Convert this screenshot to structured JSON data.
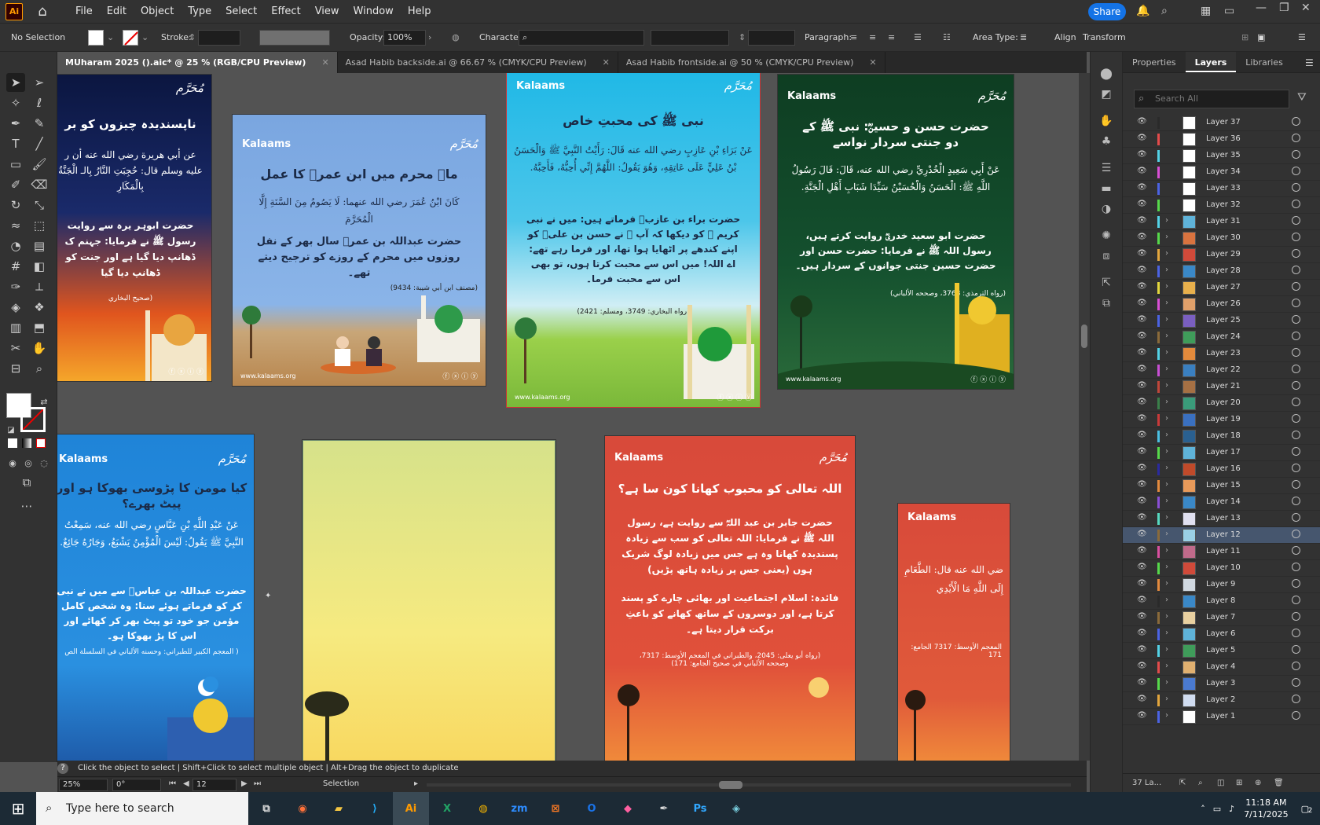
{
  "menubar": {
    "logo": "Ai",
    "items": [
      "File",
      "Edit",
      "Object",
      "Type",
      "Select",
      "Effect",
      "View",
      "Window",
      "Help"
    ],
    "share": "Share"
  },
  "control": {
    "selection": "No Selection",
    "stroke_label": "Stroke:",
    "opacity_label": "Opacity:",
    "opacity_value": "100%",
    "character_label": "Character:",
    "paragraph_label": "Paragraph:",
    "area_type_label": "Area Type:",
    "align": "Align",
    "transform": "Transform"
  },
  "tabs": [
    {
      "label": "MUharam 2025 ().aic* @ 25 % (RGB/CPU Preview)"
    },
    {
      "label": "Asad Habib backside.ai @ 66.67 % (CMYK/CPU Preview)"
    },
    {
      "label": "Asad Habib frontside.ai @ 50 % (CMYK/CPU Preview)"
    }
  ],
  "artboards": {
    "brand": "Kalaams",
    "muharram": "مُحَرَّم",
    "website": "www.kalaams.org",
    "social": "ⓕ ⓧ ⓘ ⓨ",
    "a1": {
      "title": "ناپسندیدہ چیزوں کو بر",
      "arabic": "عن أبي هريرة رضي الله عنه أن ر عليه وسلم قال: حُجِبَتِ النَّارُ بِالـ الْجَنَّةُ بِالْمَكَارِ",
      "urdu": "حضرت ابوہر یرہ سے روایت رسول ﷺ نے فرمایا: جہنم ک ڈھانپ دیا گیا ہے اور جنت کو ڈھانپ دیا گیا",
      "ref": "(صحيح البخاري"
    },
    "a2": {
      "title": "ماہ محرم میں ابن عمرؓ کا عمل",
      "arabic": "كَانَ ابْنُ عُمَرَ رضي الله عنهما: لَا يَصُومُ مِنَ السَّنَةِ إِلَّا الْمُحَرَّمَ",
      "urdu": "حضرت عبداللہ بن عمرؓ سال بھر کے نفل روزوں میں محرم کے روزے کو ترجیح دیتے تھے۔",
      "ref": "(مصنف ابن أبي شيبة: 9434)"
    },
    "a3": {
      "title": "نبی ﷺ کی محبتِ خاص",
      "arabic": "عَنْ بَرَاءِ بْنِ عَازِبٍ رضي الله عنه قَالَ: رَأَيْتُ النَّبِيَّ ﷺ وَالْحَسَنُ بْنُ عَلِيٍّ عَلَى عَاتِقِهِ، وَهُوَ يَقُولُ: اللَّهُمَّ إِنِّي أُحِبُّهُ، فَأَحِبَّهُ.",
      "urdu": "حضرت براء بن عازبؓ فرماتے ہیں: میں نے نبی کریم ﷺ کو دیکھا کہ آپ ﷺ نے حسن بن علیؓ کو اپنے کندھے پر اٹھایا ہوا تھا، اور فرما رہے تھے: اے اللہ! میں اس سے محبت کرتا ہوں، تو بھی اس سے محبت فرما۔",
      "ref": "(رواه البخاري: 3749، ومسلم: 2421)"
    },
    "a4": {
      "title": "حضرت حسن و حسینؓ: نبی ﷺ کے دو جنتی سردار نواسے",
      "arabic": "عَنْ أَبِي سَعِيدٍ الْخُدْرِيِّ رضي الله عنه، قَالَ: قَالَ رَسُولُ اللَّهِ ﷺ: الْحَسَنُ وَالْحُسَيْنُ سَيِّدَا شَبَابِ أَهْلِ الْجَنَّةِ.",
      "urdu": "حضرت ابو سعید خدریؓ روایت کرتے ہیں، رسول اللہ ﷺ نے فرمایا: حضرت حسن اور حضرت حسین جنتی جوانوں کے سردار ہیں۔",
      "ref": "(رواه الترمذي: 3768، وصححه الألباني)"
    },
    "a5": {
      "title": "کیا مومن کا پڑوسی بھوکا ہو اور پیٹ بھرے؟",
      "arabic": "عَنْ عَبْدِ اللَّهِ بْنِ عَبَّاسٍ رضي الله عنه، سَمِعْتُ النَّبِيَّ ﷺ يَقُولُ: لَيْسَ الْمُؤْمِنُ يَشْبَعُ، وَجَارُهُ جَائِعٌ.",
      "urdu": "حضرت عبداللہ بن عباسؓ سے میں نے نبی کر کو فرماتے ہوئے سنا: وہ شخص کامل مؤمن جو خود تو پیٹ بھر کر کھائے اور اس کا پڑ بھوکا ہو۔",
      "ref": "( المعجم الكبير للطبراني: وحسنه الألباني في السلسلة الص"
    },
    "a7": {
      "title": "اللہ تعالی کو محبوب کھانا کون سا ہے؟",
      "urdu": "حضرت جابر بن عبد اللہؓ سے روایت ہے، رسول اللہ ﷺ نے فرمایا: اللہ تعالی کو سب سے زیادہ پسندیدہ کھانا وہ ہے جس میں زیادہ لوگ شریک ہوں (یعنی جس پر زیادہ ہاتھ پڑیں)",
      "urdu2": "فائدہ: اسلام اجتماعیت اور بھائی چارے کو پسند کرتا ہے، اور دوسروں کے ساتھ کھانے کو باعثِ برکت قرار دیتا ہے۔",
      "ref": "(رواه أبو يعلى: 2045، والطبراني في المعجم الأوسط: 7317، وصححه الألباني في صحيح الجامع: 171)"
    },
    "a8": {
      "arabic": "ضي الله عنه قال: الطَّعَامِ إِلَى اللَّهِ مَا الْأَيْدِي",
      "ref": "المعجم الأوسط: 7317 الجامع: 171"
    }
  },
  "statusbar": {
    "hint": "Click the object to select  |  Shift+Click to select multiple object  |  Alt+Drag the object to duplicate",
    "zoom": "25%",
    "rotation": "0°",
    "artboard_num": "12",
    "mode": "Selection"
  },
  "panel": {
    "tabs": [
      "Properties",
      "Layers",
      "Libraries"
    ],
    "search_placeholder": "Search All",
    "footer": "37 La...",
    "layers": [
      {
        "name": "Layer 37",
        "color": "#2a2a2a",
        "thumb": "#ffffff",
        "chev": ""
      },
      {
        "name": "Layer 36",
        "color": "#e34b4b",
        "thumb": "#ffffff",
        "chev": ""
      },
      {
        "name": "Layer 35",
        "color": "#53d2e6",
        "thumb": "#ffffff",
        "chev": ""
      },
      {
        "name": "Layer 34",
        "color": "#d94fd5",
        "thumb": "#ffffff",
        "chev": ""
      },
      {
        "name": "Layer 33",
        "color": "#4b63e3",
        "thumb": "#ffffff",
        "chev": ""
      },
      {
        "name": "Layer 32",
        "color": "#56d94b",
        "thumb": "#ffffff",
        "chev": ""
      },
      {
        "name": "Layer 31",
        "color": "#53d2e6",
        "thumb": "#5fb3d9",
        "chev": "›"
      },
      {
        "name": "Layer 30",
        "color": "#56d94b",
        "thumb": "#d9733f",
        "chev": "›"
      },
      {
        "name": "Layer 29",
        "color": "#e3a63d",
        "thumb": "#d04a3a",
        "chev": "›"
      },
      {
        "name": "Layer 28",
        "color": "#4b63e3",
        "thumb": "#3a88c7",
        "chev": "›"
      },
      {
        "name": "Layer 27",
        "color": "#e3d73d",
        "thumb": "#e8b04c",
        "chev": "›"
      },
      {
        "name": "Layer 26",
        "color": "#d94fd5",
        "thumb": "#e0a06a",
        "chev": "›"
      },
      {
        "name": "Layer 25",
        "color": "#4b63e3",
        "thumb": "#7a5fc0",
        "chev": "›"
      },
      {
        "name": "Layer 24",
        "color": "#8a6a3a",
        "thumb": "#3f9c5a",
        "chev": "›"
      },
      {
        "name": "Layer 23",
        "color": "#53d2e6",
        "thumb": "#e28a3c",
        "chev": "›"
      },
      {
        "name": "Layer 22",
        "color": "#c94fd5",
        "thumb": "#3a7fc0",
        "chev": "›"
      },
      {
        "name": "Layer 21",
        "color": "#c0463a",
        "thumb": "#a57044",
        "chev": "›"
      },
      {
        "name": "Layer 20",
        "color": "#3a7f4a",
        "thumb": "#3a9b7a",
        "chev": "›"
      },
      {
        "name": "Layer 19",
        "color": "#c93a3a",
        "thumb": "#3a70c0",
        "chev": "›"
      },
      {
        "name": "Layer 18",
        "color": "#4bc0e3",
        "thumb": "#2a6090",
        "chev": "›"
      },
      {
        "name": "Layer 17",
        "color": "#56d94b",
        "thumb": "#5fb3d9",
        "chev": "›"
      },
      {
        "name": "Layer 16",
        "color": "#2a2aa0",
        "thumb": "#c04a2a",
        "chev": "›"
      },
      {
        "name": "Layer 15",
        "color": "#e38a3d",
        "thumb": "#e89a5a",
        "chev": "›"
      },
      {
        "name": "Layer 14",
        "color": "#8a4fd5",
        "thumb": "#3a88c7",
        "chev": "›"
      },
      {
        "name": "Layer 13",
        "color": "#56d9c0",
        "thumb": "#e0e0f0",
        "chev": "›"
      },
      {
        "name": "Layer 12",
        "color": "#8a6a3a",
        "thumb": "#9ad0e6",
        "chev": "›",
        "selected": true
      },
      {
        "name": "Layer 11",
        "color": "#d94fa0",
        "thumb": "#c06a8a",
        "chev": "›"
      },
      {
        "name": "Layer 10",
        "color": "#56d94b",
        "thumb": "#d04a3a",
        "chev": "›"
      },
      {
        "name": "Layer 9",
        "color": "#e38a3d",
        "thumb": "#d0d8e0",
        "chev": "›"
      },
      {
        "name": "Layer 8",
        "color": "#2a2a2a",
        "thumb": "#3a88c7",
        "chev": "›"
      },
      {
        "name": "Layer 7",
        "color": "#8a6a3a",
        "thumb": "#e8d0a0",
        "chev": "›"
      },
      {
        "name": "Layer 6",
        "color": "#4b63e3",
        "thumb": "#5fb3d9",
        "chev": "›"
      },
      {
        "name": "Layer 5",
        "color": "#53d2e6",
        "thumb": "#3f9c5a",
        "chev": "›"
      },
      {
        "name": "Layer 4",
        "color": "#e34b4b",
        "thumb": "#e0b070",
        "chev": "›"
      },
      {
        "name": "Layer 3",
        "color": "#56d94b",
        "thumb": "#4a7ad0",
        "chev": "›"
      },
      {
        "name": "Layer 2",
        "color": "#e3a63d",
        "thumb": "#d0dcf0",
        "chev": "›"
      },
      {
        "name": "Layer 1",
        "color": "#4b63e3",
        "thumb": "#ffffff",
        "chev": "›"
      }
    ]
  },
  "taskbar": {
    "search_placeholder": "Type here to search",
    "apps": [
      "Task View",
      "Firefox",
      "File Explorer",
      "VS Code",
      "Illustrator",
      "Excel",
      "Chrome",
      "Zoom",
      "XAMPP",
      "Outlook",
      "Affinity",
      "Pen Tool",
      "Photoshop",
      "App"
    ],
    "time": "11:18 AM",
    "date": "7/11/2025",
    "notifications": "2"
  }
}
